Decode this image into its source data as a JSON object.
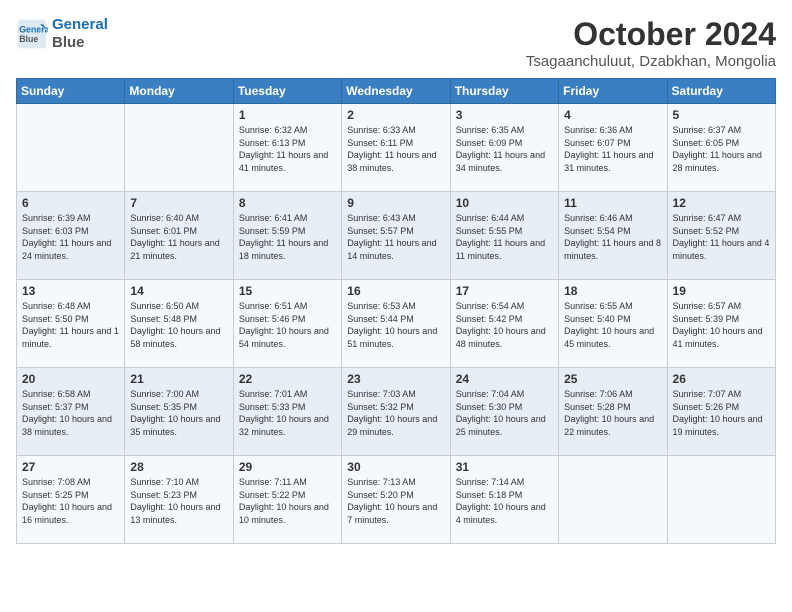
{
  "logo": {
    "line1": "General",
    "line2": "Blue"
  },
  "title": "October 2024",
  "subtitle": "Tsagaanchuluut, Dzabkhan, Mongolia",
  "days_of_week": [
    "Sunday",
    "Monday",
    "Tuesday",
    "Wednesday",
    "Thursday",
    "Friday",
    "Saturday"
  ],
  "weeks": [
    [
      {
        "day": "",
        "info": ""
      },
      {
        "day": "",
        "info": ""
      },
      {
        "day": "1",
        "info": "Sunrise: 6:32 AM\nSunset: 6:13 PM\nDaylight: 11 hours and 41 minutes."
      },
      {
        "day": "2",
        "info": "Sunrise: 6:33 AM\nSunset: 6:11 PM\nDaylight: 11 hours and 38 minutes."
      },
      {
        "day": "3",
        "info": "Sunrise: 6:35 AM\nSunset: 6:09 PM\nDaylight: 11 hours and 34 minutes."
      },
      {
        "day": "4",
        "info": "Sunrise: 6:36 AM\nSunset: 6:07 PM\nDaylight: 11 hours and 31 minutes."
      },
      {
        "day": "5",
        "info": "Sunrise: 6:37 AM\nSunset: 6:05 PM\nDaylight: 11 hours and 28 minutes."
      }
    ],
    [
      {
        "day": "6",
        "info": "Sunrise: 6:39 AM\nSunset: 6:03 PM\nDaylight: 11 hours and 24 minutes."
      },
      {
        "day": "7",
        "info": "Sunrise: 6:40 AM\nSunset: 6:01 PM\nDaylight: 11 hours and 21 minutes."
      },
      {
        "day": "8",
        "info": "Sunrise: 6:41 AM\nSunset: 5:59 PM\nDaylight: 11 hours and 18 minutes."
      },
      {
        "day": "9",
        "info": "Sunrise: 6:43 AM\nSunset: 5:57 PM\nDaylight: 11 hours and 14 minutes."
      },
      {
        "day": "10",
        "info": "Sunrise: 6:44 AM\nSunset: 5:55 PM\nDaylight: 11 hours and 11 minutes."
      },
      {
        "day": "11",
        "info": "Sunrise: 6:46 AM\nSunset: 5:54 PM\nDaylight: 11 hours and 8 minutes."
      },
      {
        "day": "12",
        "info": "Sunrise: 6:47 AM\nSunset: 5:52 PM\nDaylight: 11 hours and 4 minutes."
      }
    ],
    [
      {
        "day": "13",
        "info": "Sunrise: 6:48 AM\nSunset: 5:50 PM\nDaylight: 11 hours and 1 minute."
      },
      {
        "day": "14",
        "info": "Sunrise: 6:50 AM\nSunset: 5:48 PM\nDaylight: 10 hours and 58 minutes."
      },
      {
        "day": "15",
        "info": "Sunrise: 6:51 AM\nSunset: 5:46 PM\nDaylight: 10 hours and 54 minutes."
      },
      {
        "day": "16",
        "info": "Sunrise: 6:53 AM\nSunset: 5:44 PM\nDaylight: 10 hours and 51 minutes."
      },
      {
        "day": "17",
        "info": "Sunrise: 6:54 AM\nSunset: 5:42 PM\nDaylight: 10 hours and 48 minutes."
      },
      {
        "day": "18",
        "info": "Sunrise: 6:55 AM\nSunset: 5:40 PM\nDaylight: 10 hours and 45 minutes."
      },
      {
        "day": "19",
        "info": "Sunrise: 6:57 AM\nSunset: 5:39 PM\nDaylight: 10 hours and 41 minutes."
      }
    ],
    [
      {
        "day": "20",
        "info": "Sunrise: 6:58 AM\nSunset: 5:37 PM\nDaylight: 10 hours and 38 minutes."
      },
      {
        "day": "21",
        "info": "Sunrise: 7:00 AM\nSunset: 5:35 PM\nDaylight: 10 hours and 35 minutes."
      },
      {
        "day": "22",
        "info": "Sunrise: 7:01 AM\nSunset: 5:33 PM\nDaylight: 10 hours and 32 minutes."
      },
      {
        "day": "23",
        "info": "Sunrise: 7:03 AM\nSunset: 5:32 PM\nDaylight: 10 hours and 29 minutes."
      },
      {
        "day": "24",
        "info": "Sunrise: 7:04 AM\nSunset: 5:30 PM\nDaylight: 10 hours and 25 minutes."
      },
      {
        "day": "25",
        "info": "Sunrise: 7:06 AM\nSunset: 5:28 PM\nDaylight: 10 hours and 22 minutes."
      },
      {
        "day": "26",
        "info": "Sunrise: 7:07 AM\nSunset: 5:26 PM\nDaylight: 10 hours and 19 minutes."
      }
    ],
    [
      {
        "day": "27",
        "info": "Sunrise: 7:08 AM\nSunset: 5:25 PM\nDaylight: 10 hours and 16 minutes."
      },
      {
        "day": "28",
        "info": "Sunrise: 7:10 AM\nSunset: 5:23 PM\nDaylight: 10 hours and 13 minutes."
      },
      {
        "day": "29",
        "info": "Sunrise: 7:11 AM\nSunset: 5:22 PM\nDaylight: 10 hours and 10 minutes."
      },
      {
        "day": "30",
        "info": "Sunrise: 7:13 AM\nSunset: 5:20 PM\nDaylight: 10 hours and 7 minutes."
      },
      {
        "day": "31",
        "info": "Sunrise: 7:14 AM\nSunset: 5:18 PM\nDaylight: 10 hours and 4 minutes."
      },
      {
        "day": "",
        "info": ""
      },
      {
        "day": "",
        "info": ""
      }
    ]
  ]
}
